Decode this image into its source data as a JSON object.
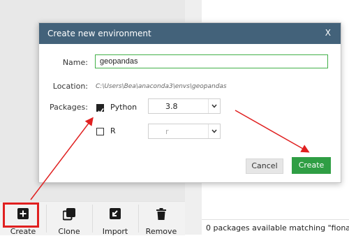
{
  "dialog": {
    "title": "Create new environment",
    "close_label": "X",
    "name_label": "Name:",
    "name_value": "geopandas",
    "location_label": "Location:",
    "location_value": "C:\\Users\\Bea\\anaconda3\\envs\\geopandas",
    "packages_label": "Packages:",
    "python": {
      "label": "Python",
      "checked": true,
      "version": "3.8"
    },
    "r": {
      "label": "R",
      "checked": false,
      "version": "r"
    },
    "cancel_label": "Cancel",
    "create_label": "Create"
  },
  "toolbar": {
    "create_label": "Create",
    "clone_label": "Clone",
    "import_label": "Import",
    "remove_label": "Remove"
  },
  "status": {
    "text": "0 packages available matching \"fiona\""
  },
  "colors": {
    "header": "#43627a",
    "create_button": "#2f9e44",
    "annotation": "#e02020"
  }
}
